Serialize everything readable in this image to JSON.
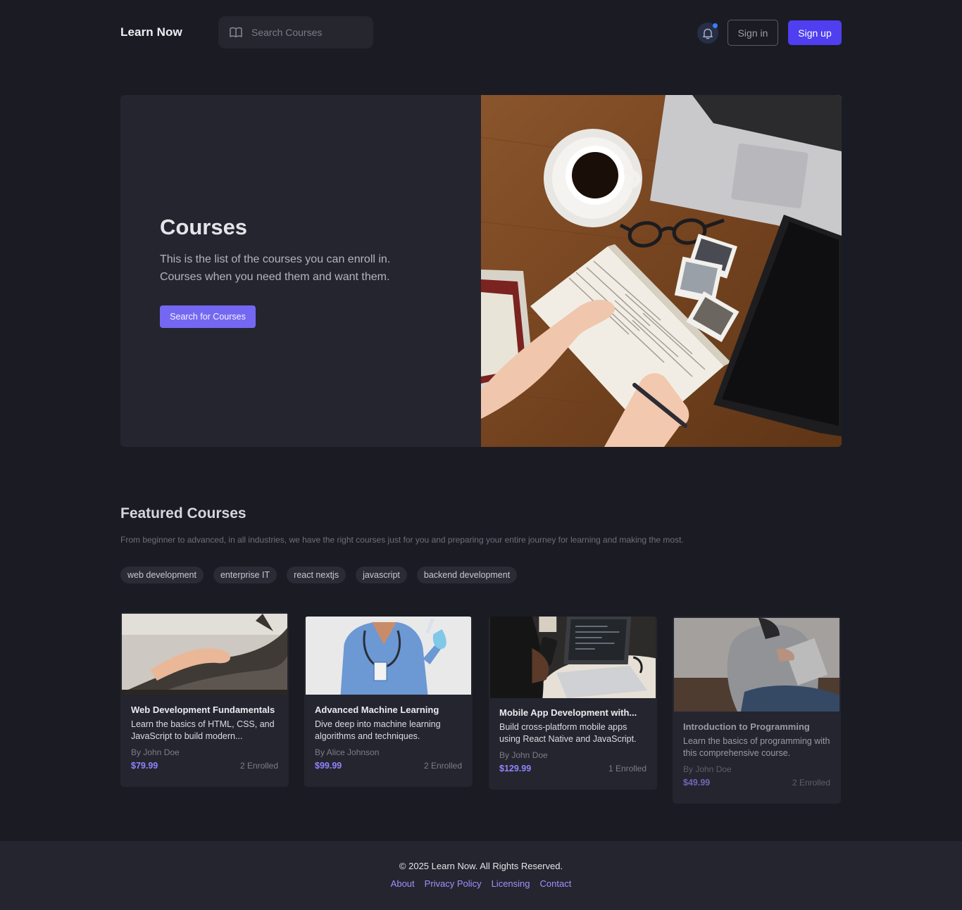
{
  "header": {
    "brand": "Learn Now",
    "search_placeholder": "Search Courses",
    "signin_label": "Sign in",
    "signup_label": "Sign up"
  },
  "hero": {
    "title": "Courses",
    "subtitle": "This is the list of the courses you can enroll in. Courses when you need them and want them.",
    "button_label": "Search for Courses"
  },
  "featured": {
    "title": "Featured Courses",
    "subtitle": "From beginner to advanced, in all industries, we have the right courses just for you and preparing your entire journey for learning and making the most.",
    "tags": [
      "web development",
      "enterprise IT",
      "react nextjs",
      "javascript",
      "backend development"
    ],
    "courses": [
      {
        "title": "Web Development Fundamentals",
        "description": "Learn the basics of HTML, CSS, and JavaScript to build modern...",
        "author": "By John Doe",
        "price": "$79.99",
        "enrolled": "2 Enrolled"
      },
      {
        "title": "Advanced Machine Learning",
        "description": "Dive deep into machine learning algorithms and techniques.",
        "author": "By Alice Johnson",
        "price": "$99.99",
        "enrolled": "2 Enrolled"
      },
      {
        "title": "Mobile App Development with...",
        "description": "Build cross-platform mobile apps using React Native and JavaScript.",
        "author": "By John Doe",
        "price": "$129.99",
        "enrolled": "1 Enrolled"
      },
      {
        "title": "Introduction to Programming",
        "description": "Learn the basics of programming with this comprehensive course.",
        "author": "By John Doe",
        "price": "$49.99",
        "enrolled": "2 Enrolled"
      }
    ]
  },
  "footer": {
    "copyright": "© 2025 Learn Now. All Rights Reserved.",
    "links": [
      "About",
      "Privacy Policy",
      "Licensing",
      "Contact"
    ]
  },
  "colors": {
    "background": "#1b1b23",
    "surface": "#25252f",
    "accent": "#4f3ff0",
    "accent_light": "#8f84ff"
  }
}
